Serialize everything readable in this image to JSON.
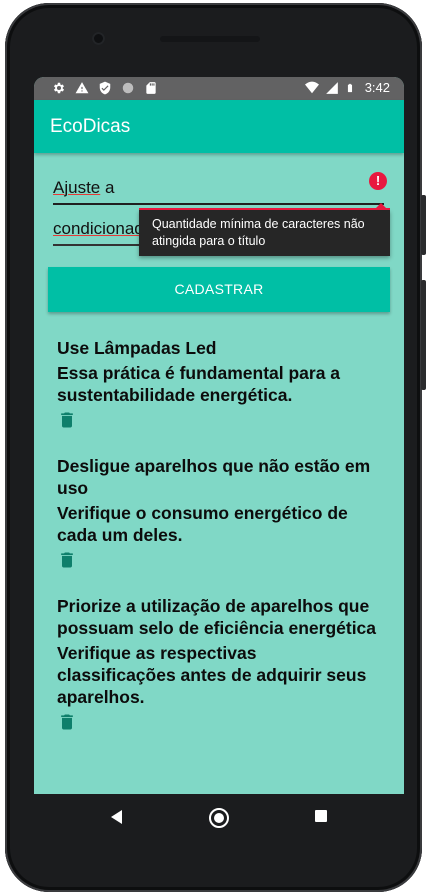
{
  "statusbar": {
    "time": "3:42",
    "left_icons": [
      "gear-icon",
      "warning-icon",
      "shield-icon",
      "circle-icon",
      "sd-card-icon"
    ],
    "right_icons": [
      "wifi-icon",
      "signal-icon",
      "battery-icon"
    ]
  },
  "appbar": {
    "title": "EcoDicas"
  },
  "form": {
    "title_field_value": "Ajuste a",
    "title_field_value_underlined": "Ajuste",
    "title_field_value_rest": " a",
    "desc_field_value": "condicionado",
    "error_tooltip": "Quantidade mínima de caracteres não atingida para o título",
    "error_color": "#e8183f",
    "submit_label": "CADASTRAR"
  },
  "tips": [
    {
      "title": "Use Lâmpadas Led",
      "description": "Essa prática é fundamental para a sustentabilidade energética."
    },
    {
      "title": "Desligue aparelhos que não estão em uso",
      "description": "Verifique o consumo energético de cada um deles."
    },
    {
      "title": "Priorize a utilização de aparelhos que possuam selo de eficiência energética",
      "description": "Verifique as respectivas classificações antes de adquirir seus aparelhos."
    }
  ],
  "colors": {
    "primary": "#00bfa5",
    "background": "#80d8c6",
    "trash_icon": "#0e7f6b",
    "statusbar": "#626263"
  },
  "navbar": {
    "buttons": [
      "back-icon",
      "home-icon",
      "recents-icon"
    ]
  }
}
